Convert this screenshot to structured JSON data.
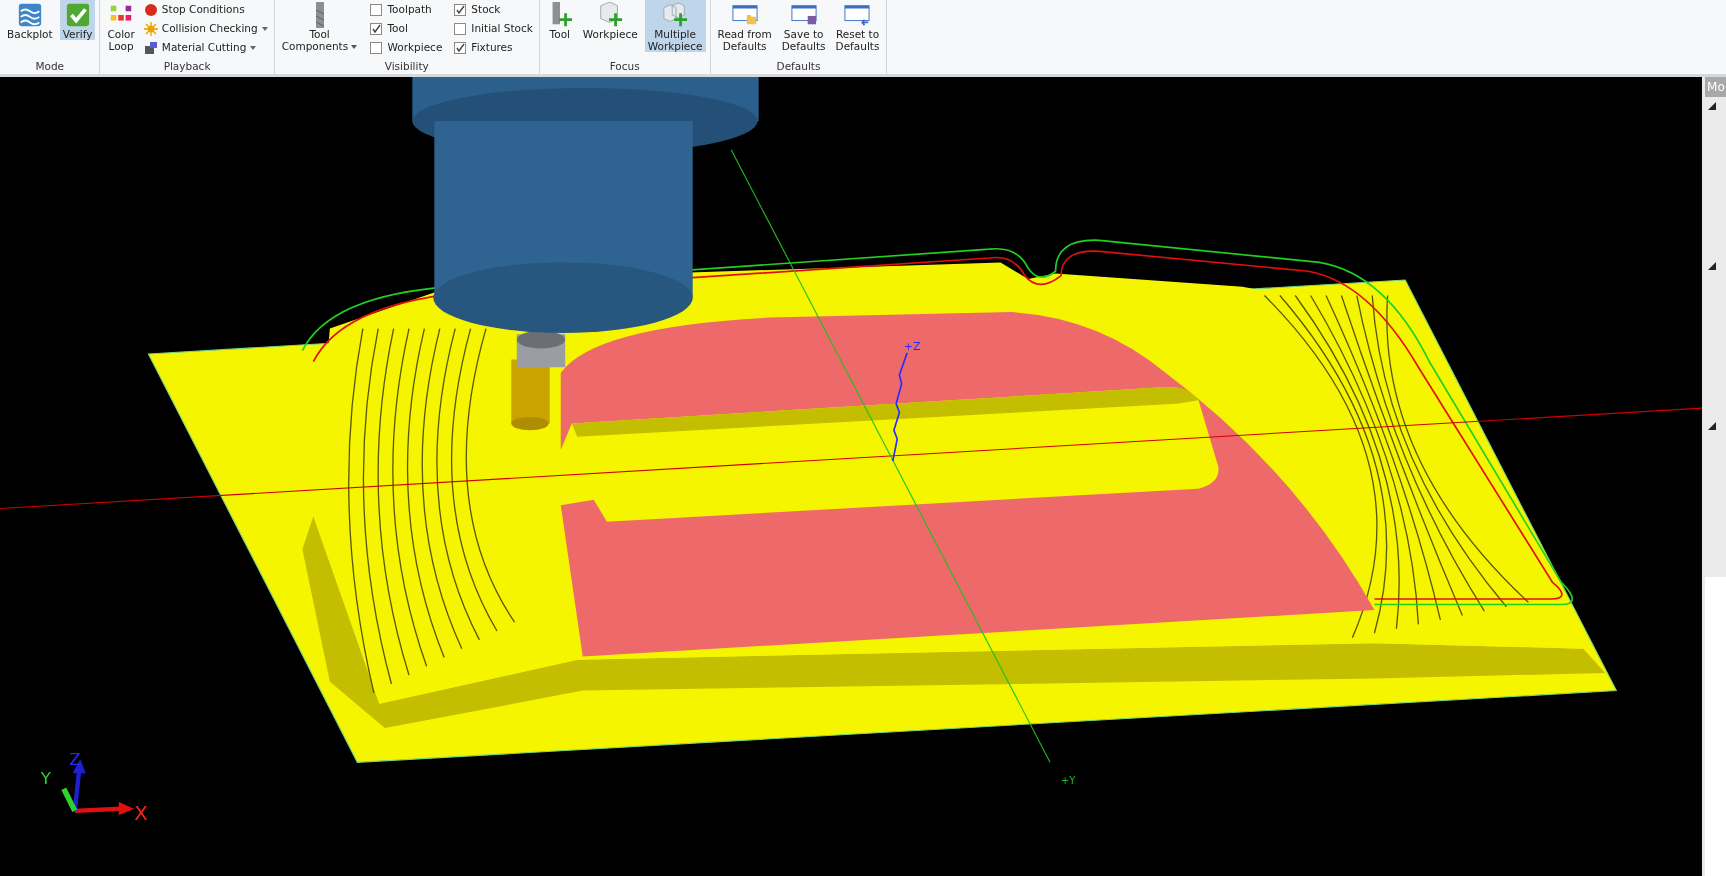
{
  "ribbon": {
    "groups": [
      {
        "label": "Mode",
        "items": [
          {
            "kind": "large",
            "lines": [
              "Backplot"
            ],
            "dropdown": false,
            "selected": false
          },
          {
            "kind": "large",
            "lines": [
              "Verify"
            ],
            "dropdown": false,
            "selected": true
          }
        ]
      },
      {
        "label": "Playback",
        "items": [
          {
            "kind": "large",
            "lines": [
              "Color",
              "Loop"
            ],
            "dropdown": false
          },
          {
            "kind": "small",
            "label": "Stop Conditions",
            "dropdown": false
          },
          {
            "kind": "small",
            "label": "Collision Checking",
            "dropdown": true
          },
          {
            "kind": "small",
            "label": "Material Cutting",
            "dropdown": true
          }
        ]
      },
      {
        "label": "Visibility",
        "items": [
          {
            "kind": "large",
            "lines": [
              "Tool",
              "Components"
            ],
            "dropdown": true
          },
          {
            "kind": "check",
            "label": "Toolpath",
            "checked": false
          },
          {
            "kind": "check",
            "label": "Tool",
            "checked": true
          },
          {
            "kind": "check",
            "label": "Workpiece",
            "checked": false
          },
          {
            "kind": "check",
            "label": "Stock",
            "checked": true
          },
          {
            "kind": "check",
            "label": "Initial Stock",
            "checked": false
          },
          {
            "kind": "check",
            "label": "Fixtures",
            "checked": true
          }
        ]
      },
      {
        "label": "Focus",
        "items": [
          {
            "kind": "large",
            "lines": [
              "Tool"
            ],
            "dropdown": false,
            "selected": false
          },
          {
            "kind": "large",
            "lines": [
              "Workpiece"
            ],
            "dropdown": false,
            "selected": false
          },
          {
            "kind": "large",
            "lines": [
              "Multiple",
              "Workpiece"
            ],
            "dropdown": false,
            "selected": true
          }
        ]
      },
      {
        "label": "Defaults",
        "items": [
          {
            "kind": "large",
            "lines": [
              "Read from",
              "Defaults"
            ],
            "dropdown": false
          },
          {
            "kind": "large",
            "lines": [
              "Save to",
              "Defaults"
            ],
            "dropdown": false
          },
          {
            "kind": "large",
            "lines": [
              "Reset to",
              "Defaults"
            ],
            "dropdown": false
          }
        ]
      }
    ]
  },
  "viewport": {
    "axis_labels": [
      "+Z",
      "+Y"
    ],
    "triad": {
      "x": "X",
      "y": "Y",
      "z": "Z"
    }
  },
  "side_panel": {
    "header": "Mo",
    "sections": [
      {
        "expanded": true
      },
      {
        "expanded": true
      },
      {
        "expanded": true
      }
    ]
  }
}
